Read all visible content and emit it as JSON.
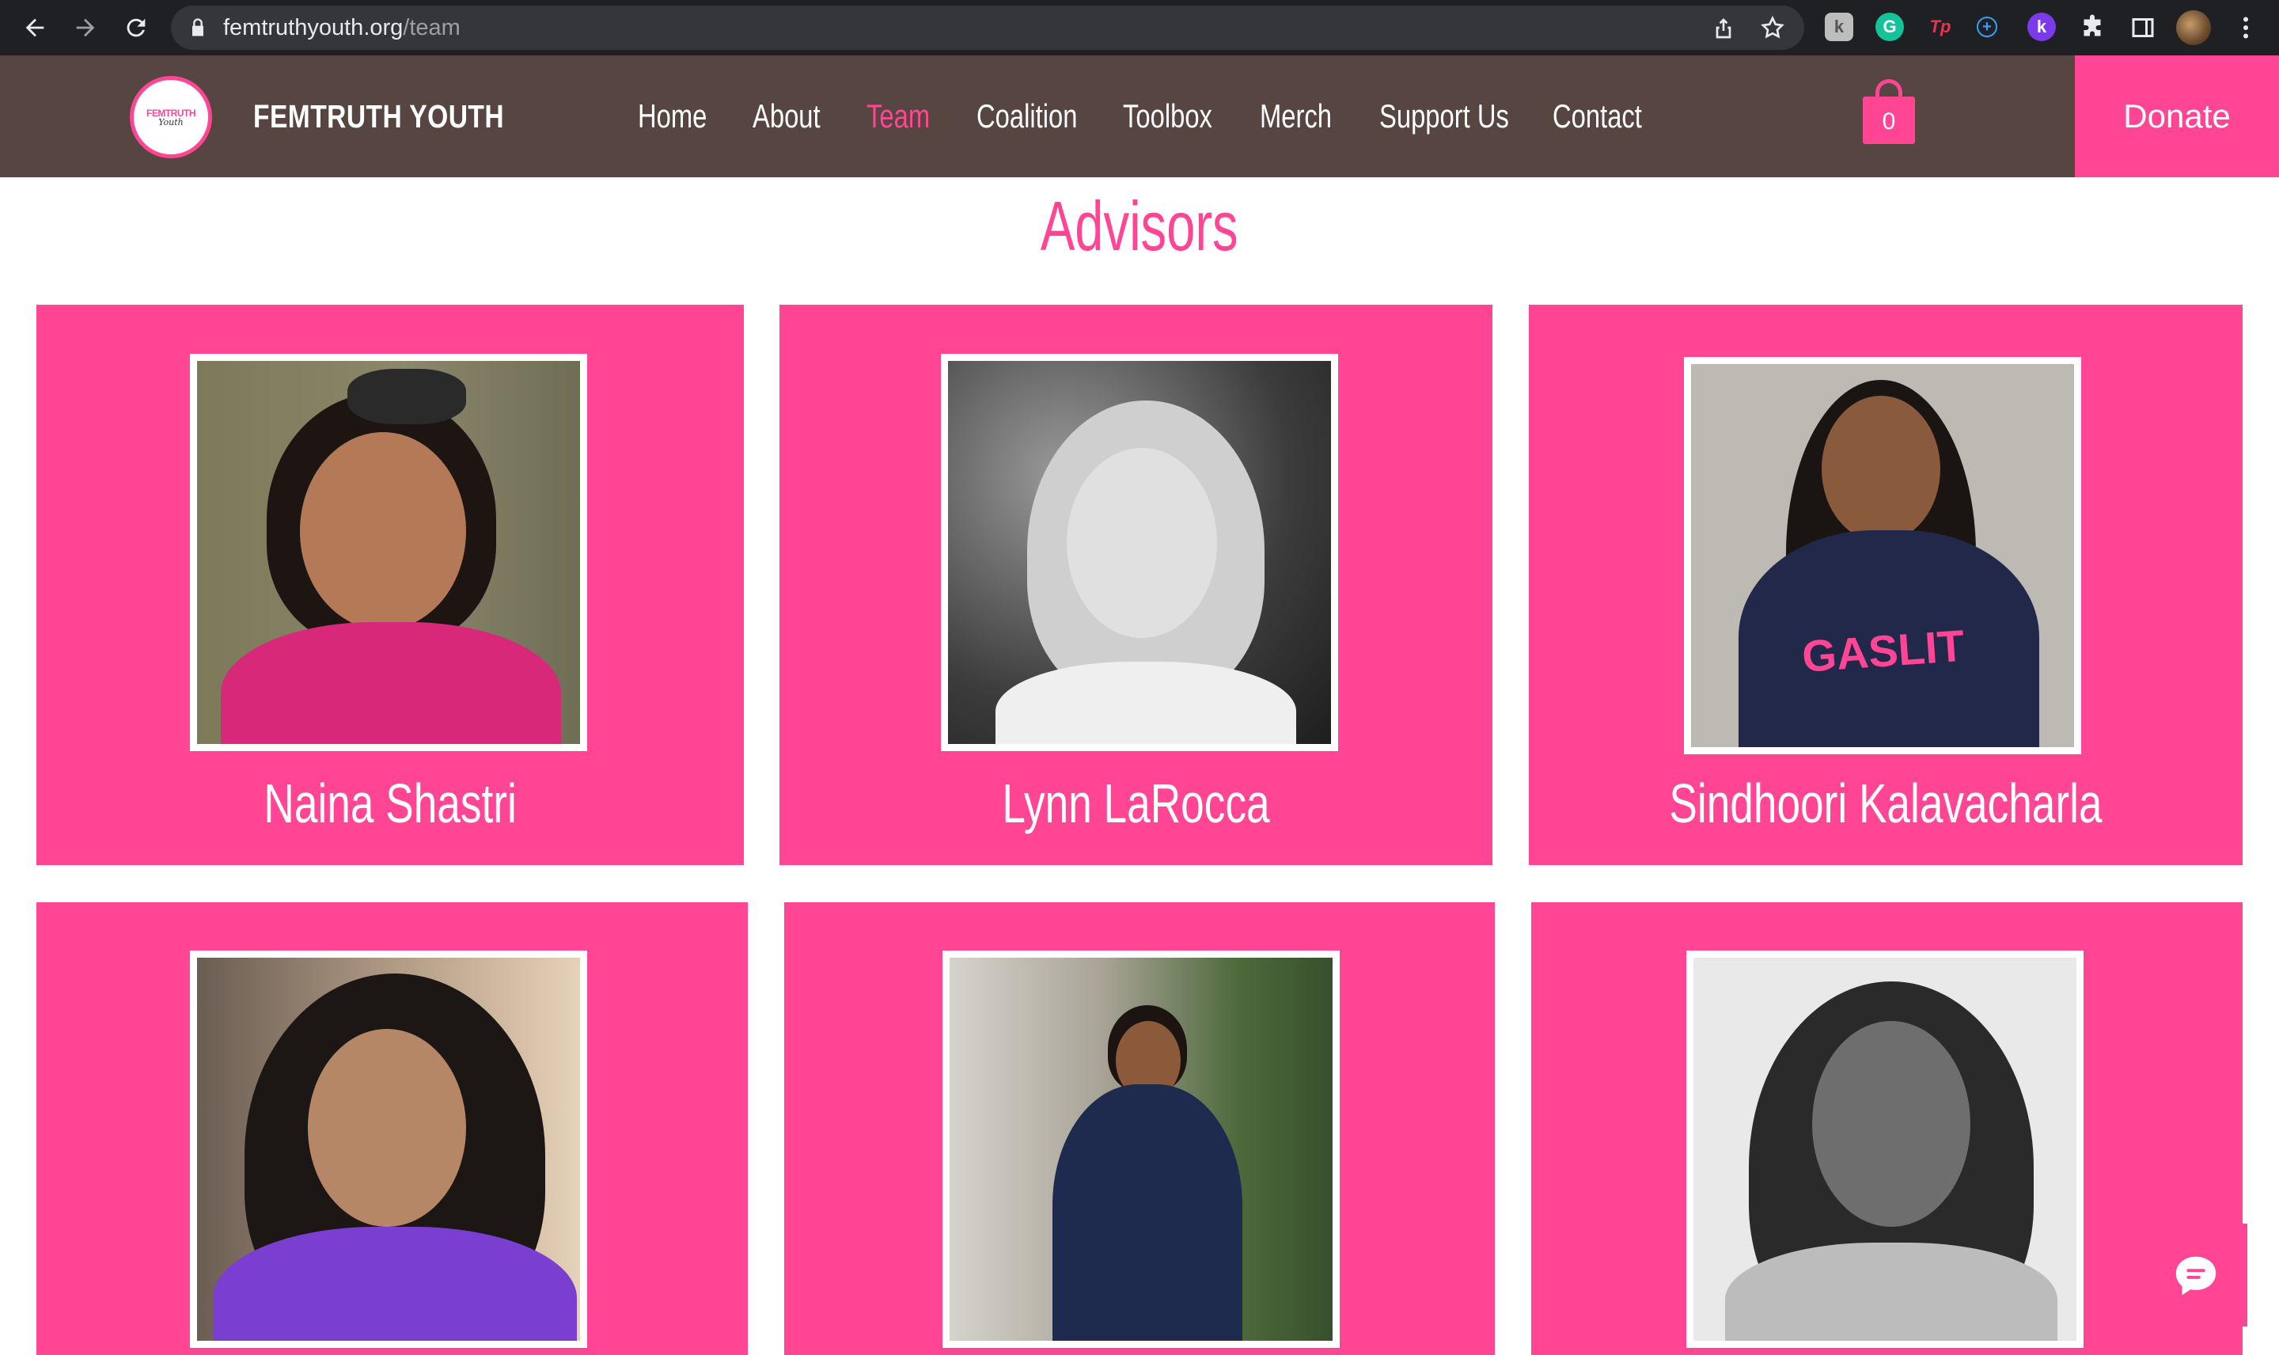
{
  "browser": {
    "url_host": "femtruthyouth.org",
    "url_path": "/team",
    "extensions": [
      {
        "name": "extension-k-icon",
        "label": "k",
        "color": "#bdbdbd"
      },
      {
        "name": "grammarly-icon",
        "label": "G",
        "color": "#15c39a"
      },
      {
        "name": "tp-icon",
        "label": "Tp",
        "color": "#e8344e"
      },
      {
        "name": "plus-circle-icon",
        "label": "+",
        "color": "#3b82f6"
      },
      {
        "name": "kami-icon",
        "label": "k",
        "color": "#7c3aed"
      }
    ]
  },
  "header": {
    "logo_text_1": "FEMTRUTH",
    "logo_text_2": "Youth",
    "brand": "FEMTRUTH YOUTH",
    "nav": [
      "Home",
      "About",
      "Team",
      "Coalition",
      "Toolbox",
      "Merch",
      "Support Us",
      "Contact"
    ],
    "active_nav": "Team",
    "cart_count": "0",
    "donate_label": "Donate"
  },
  "colors": {
    "accent": "#ff4594",
    "header_bg": "#564541"
  },
  "section": {
    "title": "Advisors"
  },
  "advisors": [
    {
      "name": "Naina Shastri"
    },
    {
      "name": "Lynn LaRocca"
    },
    {
      "name": "Sindhoori Kalavacharla"
    },
    {
      "name": ""
    },
    {
      "name": ""
    },
    {
      "name": ""
    }
  ]
}
